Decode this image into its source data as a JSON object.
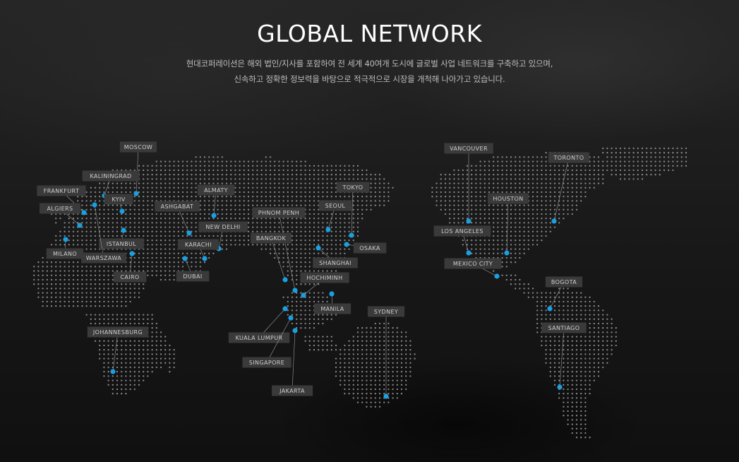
{
  "header": {
    "title": "GLOBAL NETWORK",
    "description_line1": "현대코퍼레이션은 해외 법인/지사를 포함하여 전 세계 40여개 도시에 글로벌 사업 네트워크를 구축하고 있으며,",
    "description_line2": "신속하고 정확한 정보력을 바탕으로 적극적으로 시장을 개척해 나아가고 있습니다."
  },
  "colors": {
    "marker": "#1a9fe0",
    "dot": "#8a8a8a",
    "label_bg": "#3a3a3a",
    "label_text": "#cfcfcf"
  },
  "cities": [
    {
      "id": "moscow",
      "name": "MOSCOW"
    },
    {
      "id": "kaliningrad",
      "name": "KALININGRAD"
    },
    {
      "id": "frankfurt",
      "name": "FRANKFURT"
    },
    {
      "id": "kyiv",
      "name": "KYIV"
    },
    {
      "id": "algiers",
      "name": "ALGIERS"
    },
    {
      "id": "ashgabat",
      "name": "ASHGABAT"
    },
    {
      "id": "almaty",
      "name": "ALMATY"
    },
    {
      "id": "new-delhi",
      "name": "NEW DELHI"
    },
    {
      "id": "istanbul",
      "name": "ISTANBUL"
    },
    {
      "id": "milano",
      "name": "MILANO"
    },
    {
      "id": "warszawa",
      "name": "WARSZAWA"
    },
    {
      "id": "karachi",
      "name": "KARACHI"
    },
    {
      "id": "cairo",
      "name": "CAIRO"
    },
    {
      "id": "dubai",
      "name": "DUBAI"
    },
    {
      "id": "phnom-penh",
      "name": "PHNOM PENH"
    },
    {
      "id": "bangkok",
      "name": "BANGKOK"
    },
    {
      "id": "tokyo",
      "name": "TOKYO"
    },
    {
      "id": "seoul",
      "name": "SEOUL"
    },
    {
      "id": "osaka",
      "name": "OSAKA"
    },
    {
      "id": "shanghai",
      "name": "SHANGHAI"
    },
    {
      "id": "hochiminh",
      "name": "HOCHIMINH"
    },
    {
      "id": "manila",
      "name": "MANILA"
    },
    {
      "id": "sydney",
      "name": "SYDNEY"
    },
    {
      "id": "johannesburg",
      "name": "JOHANNESBURG"
    },
    {
      "id": "kuala-lumpur",
      "name": "KUALA LUMPUR"
    },
    {
      "id": "singapore",
      "name": "SINGAPORE"
    },
    {
      "id": "jakarta",
      "name": "JAKARTA"
    },
    {
      "id": "vancouver",
      "name": "VANCOUVER"
    },
    {
      "id": "toronto",
      "name": "TORONTO"
    },
    {
      "id": "houston",
      "name": "HOUSTON"
    },
    {
      "id": "los-angeles",
      "name": "LOS ANGELES"
    },
    {
      "id": "mexico-city",
      "name": "MEXICO CITY"
    },
    {
      "id": "bogota",
      "name": "BOGOTA"
    },
    {
      "id": "santiago",
      "name": "SANTIAGO"
    }
  ]
}
